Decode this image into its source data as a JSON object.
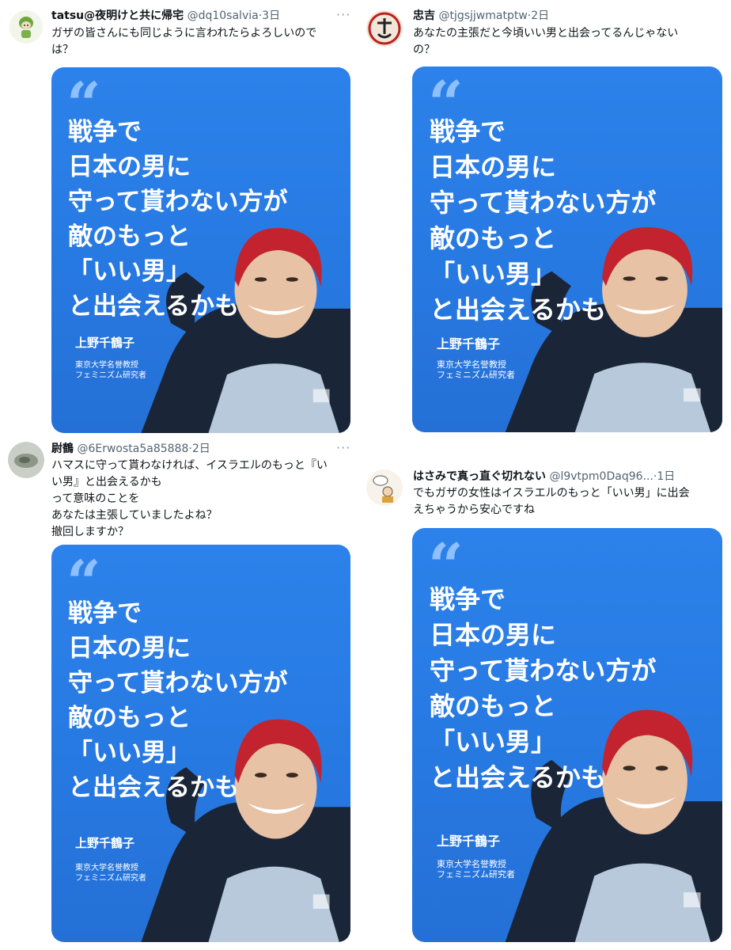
{
  "tweets": [
    {
      "name": "tatsu@夜明けと共に帰宅",
      "handle": "@dq10salvia",
      "time": "3日",
      "text": [
        "ガザの皆さんにも同じように言われたらよろしいので",
        "は？"
      ],
      "avatar_icon": "character-avatar-icon"
    },
    {
      "name": "忠吉",
      "handle": "@tjgsjjwmatptw",
      "time": "2日",
      "text": [
        "あなたの主張だと今頃いい男と出会ってるんじゃない",
        "の？"
      ],
      "avatar_icon": "kanji-avatar-icon"
    },
    {
      "name": "尉鶴",
      "handle": "@6Erwosta5a85888",
      "time": "2日",
      "text": [
        "ハマスに守って貰わなければ、イスラエルのもっと『い",
        "い男』と出会えるかも",
        "って意味のことを",
        "あなたは主張していましたよね？",
        "撤回しますか？"
      ],
      "avatar_icon": "photo-avatar-icon"
    },
    {
      "name": "はさみで真っ直ぐ切れない",
      "handle": "@l9vtpm0Daq96...",
      "time": "1日",
      "text": [
        "でもガザの女性はイスラエルのもっと「いい男」に出会",
        "えちゃうから安心ですね"
      ],
      "avatar_icon": "drawing-avatar-icon"
    }
  ],
  "separator": "·",
  "more_glyph": "···",
  "card": {
    "quote_mark": "“",
    "lines": [
      "戦争で",
      "日本の男に",
      "守って貰わない方が",
      "敵のもっと",
      "「いい男」",
      "と出会えるかも"
    ],
    "author": "上野千鶴子",
    "affiliation": [
      "東京大学名誉教授",
      "フェミニズム研究者"
    ]
  },
  "colors": {
    "card_blue": "#2a7de6",
    "quote": "#8ec0ff",
    "hair": "#c2232e",
    "handle_gray": "#536471"
  }
}
